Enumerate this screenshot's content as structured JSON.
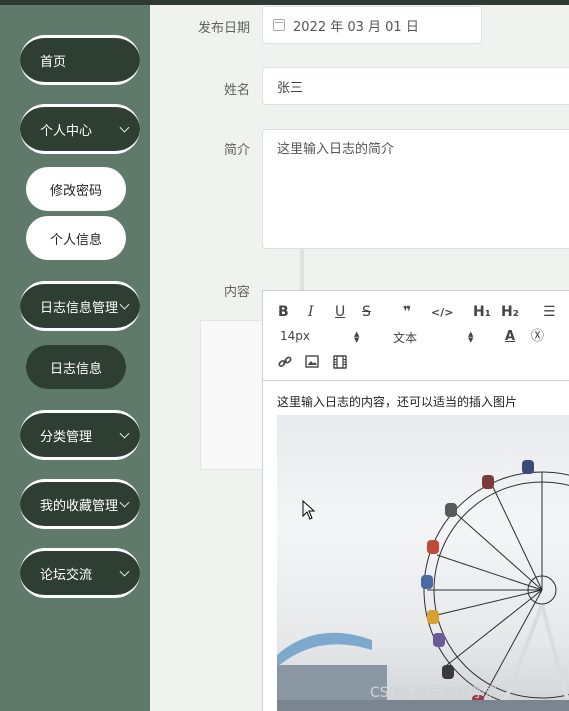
{
  "sidebar": {
    "home": "首页",
    "personal_center": "个人中心",
    "change_password": "修改密码",
    "personal_info": "个人信息",
    "diary_mgmt": "日志信息管理",
    "diary_info": "日志信息",
    "category_mgmt": "分类管理",
    "favorites_mgmt": "我的收藏管理",
    "forum": "论坛交流"
  },
  "form": {
    "publish_date_label": "发布日期",
    "publish_date_value": "2022 年 03 月 01 日",
    "name_label": "姓名",
    "name_value": "张三",
    "intro_label": "简介",
    "intro_value": "这里输入日志的简介",
    "content_label": "内容"
  },
  "editor": {
    "font_size": "14px",
    "font_family": "文本",
    "buttons": {
      "bold": "B",
      "italic": "I",
      "underline": "U",
      "strike": "S",
      "quote": "❞",
      "code": "</>",
      "h1": "H₁",
      "h2": "H₂",
      "list": "☰",
      "text_color": "A",
      "clear": "Ⓧ"
    },
    "content_text": "这里输入日志的内容，还可以适当的插入图片"
  },
  "watermark": "CSDN @豆包程序员",
  "colors": {
    "sidebar_bg": "#5f7a6b",
    "pill_bg": "#2f3e33",
    "accent_white": "#ffffff"
  }
}
